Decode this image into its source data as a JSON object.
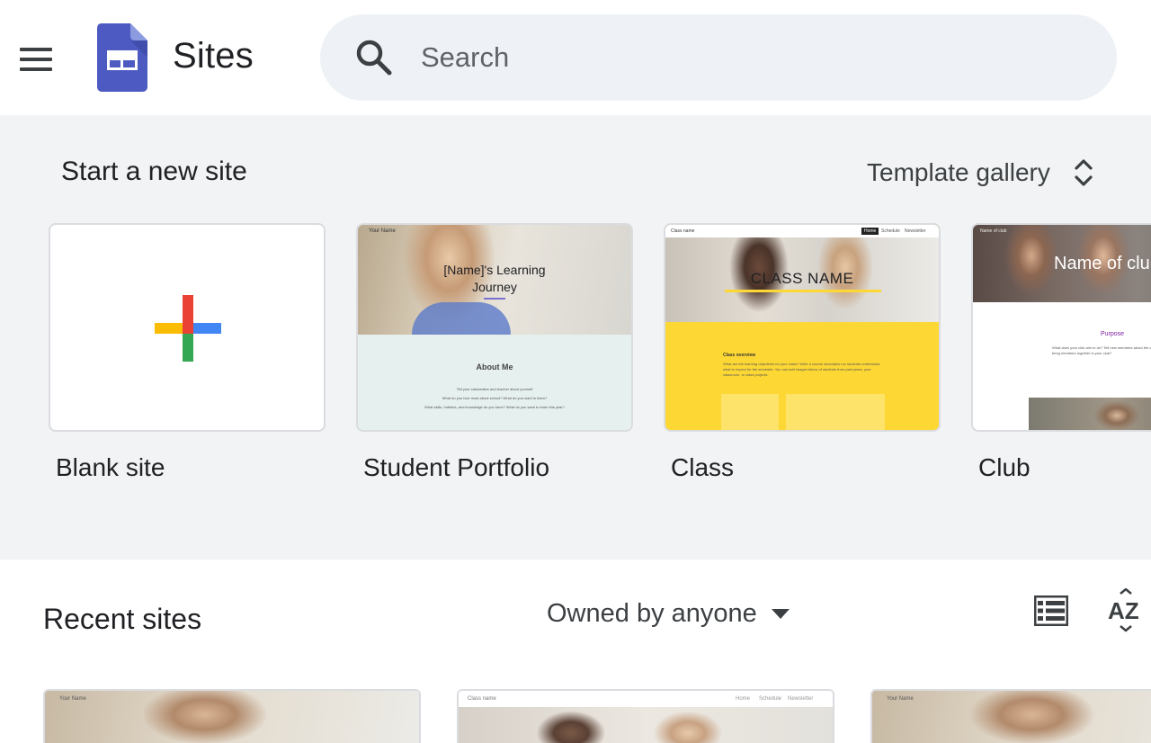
{
  "header": {
    "app_name": "Sites",
    "search_placeholder": "Search",
    "icons": {
      "menu": "hamburger-menu-icon",
      "logo": "google-sites-logo",
      "search": "search-icon"
    }
  },
  "templates": {
    "title": "Start a new site",
    "gallery_label": "Template gallery",
    "cards": [
      {
        "label": "Blank site"
      },
      {
        "label": "Student Portfolio",
        "thumb": {
          "nav": "Your Name",
          "hero_title_line1": "[Name]'s Learning",
          "hero_title_line2": "Journey",
          "section_title": "About Me",
          "body1": "Tell your classmates and teacher about yourself",
          "body2": "What do you love most about school? What do you want to learn?",
          "body3": "What skills, hobbies, and knowledge do you have? What do you want to learn this year?"
        }
      },
      {
        "label": "Class",
        "thumb": {
          "nav": "Class name",
          "nav_links": [
            "Home",
            "Schedule",
            "Newsletter"
          ],
          "hero_title": "CLASS NAME",
          "overview_title": "Class overview",
          "overview_text": "What are the learning objectives for your class? Write a course description so students understand what to expect for the semester. You can add images below of students from past years, your classroom, or class projects."
        }
      },
      {
        "label": "Club",
        "thumb": {
          "nav": "Name of club",
          "hero_title": "Name of club",
          "section_title": "Purpose",
          "body": "What does your club aim to do? Tell new members about the club and what it hopes to achieve. What are the values that bring members together in your club?"
        }
      }
    ],
    "colors": {
      "google_red": "#EA4335",
      "google_blue": "#4285F4",
      "google_yellow": "#FBBC04",
      "google_green": "#34A853",
      "class_yellow": "#FDD835",
      "portfolio_mint": "#E6F0EE",
      "club_purple": "#7B1FA2"
    }
  },
  "recent": {
    "title": "Recent sites",
    "owner_filter": "Owned by anyone",
    "icons": {
      "list_view": "list-view-icon",
      "sort": "sort-az-icon",
      "dropdown": "dropdown-arrow-icon"
    },
    "items": [
      {
        "nav": "Your Name"
      },
      {
        "nav": "Class name",
        "nav_links": [
          "Home",
          "Schedule",
          "Newsletter"
        ]
      },
      {
        "nav": "Your Name"
      }
    ]
  }
}
